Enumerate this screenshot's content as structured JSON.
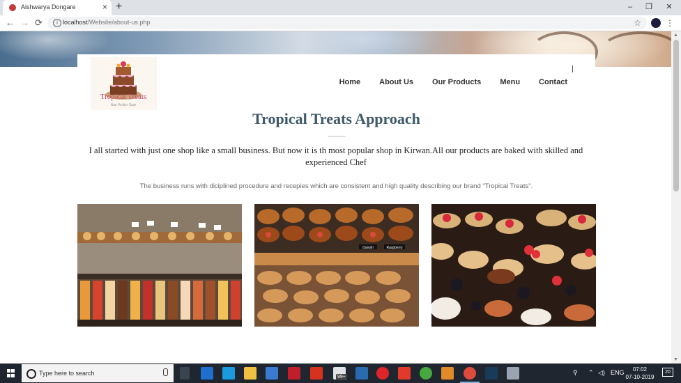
{
  "browser": {
    "tab_title": "Aishwarya Dongare",
    "tab_close": "×",
    "new_tab": "+",
    "url_host": "localhost",
    "url_path": "/Website/about-us.php",
    "info_glyph": "i",
    "window_controls": {
      "minimize": "–",
      "restore": "❐",
      "close": "✕"
    },
    "nav": {
      "back": "←",
      "forward": "→",
      "reload": "⟳"
    },
    "star": "☆",
    "menu": "⋮"
  },
  "site": {
    "logo_text": "Tropical Treats",
    "logo_tagline": "Your Perfect Taste",
    "nav": [
      "Home",
      "About Us",
      "Our Products",
      "Menu",
      "Contact"
    ],
    "heading": "Tropical Treats Approach",
    "intro": "I all started with just one shop like a small business. But now it is th most popular shop in Kirwan.All our products are baked with skilled and experienced Chef",
    "subtext": "The business runs with diciplined procedure and recepies which are consistent and high quality describing our brand \"Tropical Treats\".",
    "photos": [
      {
        "label": "Pastry display case"
      },
      {
        "label": "Danish pastries",
        "tags": [
          "Danish",
          "Raspberry"
        ]
      },
      {
        "label": "Berry tartlets"
      }
    ]
  },
  "taskbar": {
    "search_placeholder": "Type here to search",
    "badge": "99+",
    "tray_lang": "ENG",
    "time": "07:02",
    "date": "07-10-2019",
    "notifications": "20"
  },
  "colors": {
    "heading": "#3e5a6a",
    "taskbar": "#1f2630",
    "tab_strip": "#dee1e6"
  }
}
